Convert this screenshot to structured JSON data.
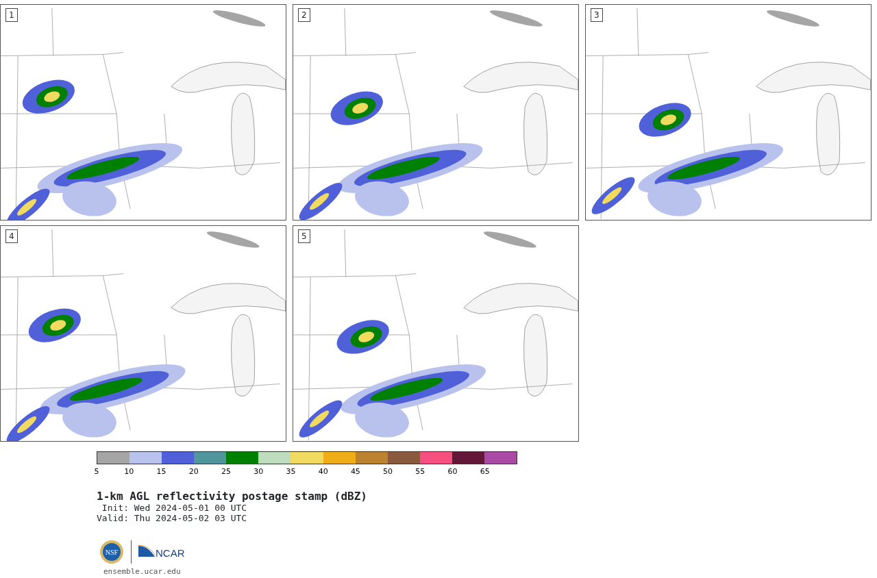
{
  "panels": [
    {
      "label": "1"
    },
    {
      "label": "2"
    },
    {
      "label": "3"
    },
    {
      "label": "4"
    },
    {
      "label": "5"
    }
  ],
  "colorbar": {
    "segments": [
      {
        "color": "#a5a5a5",
        "tick": "5"
      },
      {
        "color": "#b8c2ec",
        "tick": "10"
      },
      {
        "color": "#5060d8",
        "tick": "15"
      },
      {
        "color": "#50969c",
        "tick": "20"
      },
      {
        "color": "#008000",
        "tick": "25"
      },
      {
        "color": "#bedcbe",
        "tick": "30"
      },
      {
        "color": "#f0da60",
        "tick": "35"
      },
      {
        "color": "#efae18",
        "tick": "40"
      },
      {
        "color": "#bb8230",
        "tick": "45"
      },
      {
        "color": "#8b5a3e",
        "tick": "50"
      },
      {
        "color": "#f55080",
        "tick": "55"
      },
      {
        "color": "#641838",
        "tick": "60"
      },
      {
        "color": "#aa4aa4",
        "tick": "65"
      }
    ]
  },
  "title": "1-km AGL reflectivity postage stamp (dBZ)",
  "init": " Init: Wed 2024-05-01 00 UTC",
  "valid": "Valid: Thu 2024-05-02 03 UTC",
  "logos": {
    "nsf": "NSF",
    "ncar": "NCAR"
  },
  "footer": "ensemble.ucar.edu"
}
